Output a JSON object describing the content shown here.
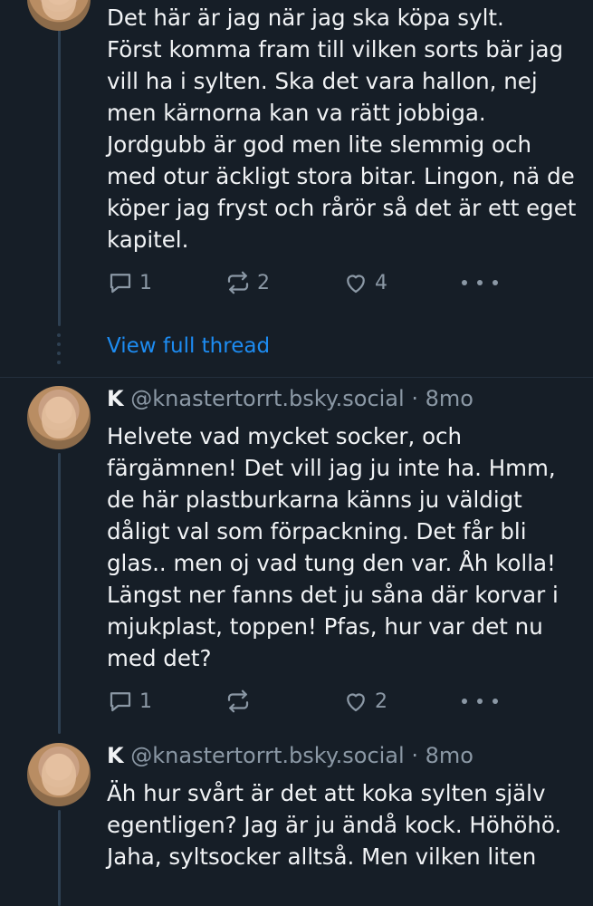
{
  "posts": [
    {
      "text": "Det här är jag när jag ska köpa sylt.\nFörst komma fram till vilken sorts bär jag vill ha i sylten. Ska det vara hallon, nej men kärnorna kan va rätt jobbiga. Jordgubb är god men lite slemmig och med otur äckligt stora bitar. Lingon, nä de köper jag fryst och rårör så det är ett eget kapitel.",
      "reply_count": "1",
      "repost_count": "2",
      "like_count": "4"
    },
    {
      "display_name": "K",
      "handle": "@knastertorrt.bsky.social",
      "separator": "·",
      "time": "8mo",
      "text": "Helvete vad mycket socker, och färgämnen! Det vill jag ju inte ha. Hmm, de här plastburkarna känns ju väldigt dåligt val som förpackning. Det får bli glas.. men oj vad tung den var. Åh kolla! Längst ner fanns det ju såna där korvar i mjukplast, toppen! Pfas, hur var det nu med det?",
      "reply_count": "1",
      "repost_count": "",
      "like_count": "2"
    },
    {
      "display_name": "K",
      "handle": "@knastertorrt.bsky.social",
      "separator": "·",
      "time": "8mo",
      "text": "Äh hur svårt är det att koka sylten själv egentligen? Jag är ju ändå kock. Höhöhö.\nJaha, syltsocker alltså. Men vilken liten"
    }
  ],
  "view_full_thread": "View full thread",
  "icons": [
    "reply-icon",
    "repost-icon",
    "like-icon",
    "more-options-icon"
  ],
  "colors": {
    "background": "#161e27",
    "text": "#f1f3f5",
    "muted": "#8b98a5",
    "link": "#1d8cf2",
    "thread_line": "#2e4052"
  }
}
